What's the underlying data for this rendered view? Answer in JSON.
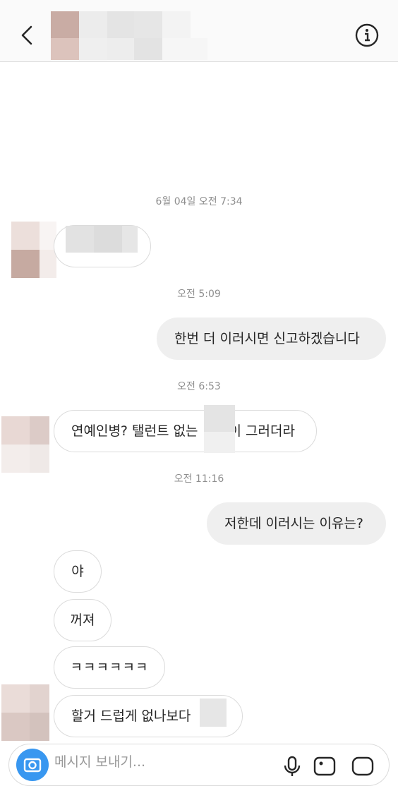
{
  "header": {
    "back_icon": "chevron-left-icon",
    "info_icon": "info-icon",
    "contact_name_blurred": true
  },
  "thread": {
    "timestamps": [
      "6월 04일 오전 7:34",
      "오전 5:09",
      "오전 6:53",
      "오전 11:16"
    ],
    "messages": [
      {
        "side": "in",
        "text": ""
      },
      {
        "side": "out",
        "text": "한번 더 이러시면 신고하겠습니다"
      },
      {
        "side": "in",
        "text": "연예인병? 탤런트 없는",
        "text_after_blur": "이 그러더라"
      },
      {
        "side": "out",
        "text": "저한데 이러시는 이유는?"
      },
      {
        "side": "in",
        "text": "야"
      },
      {
        "side": "in",
        "text": "꺼져"
      },
      {
        "side": "in",
        "text": "ㅋㅋㅋㅋㅋㅋ"
      },
      {
        "side": "in",
        "text": "할거 드럽게 없나보다"
      }
    ]
  },
  "composer": {
    "placeholder": "메시지 보내기...",
    "camera_icon": "camera-icon",
    "icons": [
      "microphone-icon",
      "image-icon",
      "sticker-icon"
    ]
  },
  "colors": {
    "incoming_border": "#dbdbdb",
    "outgoing_bg": "#efefef",
    "accent": "#3897f0",
    "timestamp": "#8e8e8e"
  }
}
